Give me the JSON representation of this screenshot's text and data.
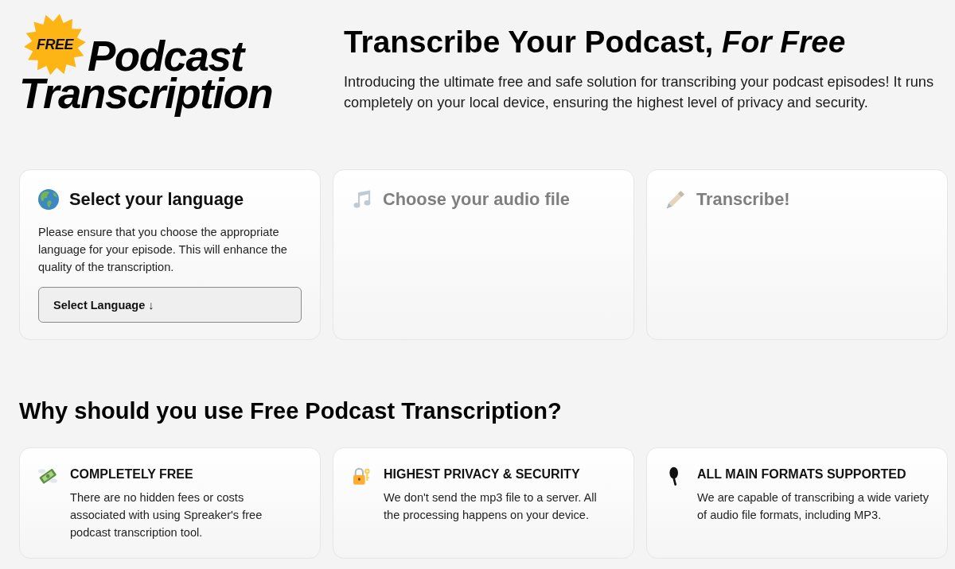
{
  "logo": {
    "badge": "FREE",
    "lines": [
      "Podcast",
      "Transcription"
    ]
  },
  "hero": {
    "title": "Transcribe Your Podcast, *For Free*",
    "intro": "Introducing the ultimate free and safe solution for transcribing your podcast episodes! It runs completely on your local device, ensuring the highest level of privacy and security."
  },
  "steps": [
    {
      "title": "Select your language",
      "disabled": false,
      "description": "Please ensure that you choose the appropriate language for your episode. This will enhance the quality of the transcription.",
      "button": "Select Language ↓"
    },
    {
      "title": "Choose your audio file",
      "disabled": true
    },
    {
      "title": "Transcribe!",
      "disabled": true
    }
  ],
  "features": {
    "heading": "Why should you use Free Podcast Transcription?",
    "items": [
      {
        "title": "COMPLETELY FREE",
        "description": "There are no hidden fees or costs associated with using Spreaker's free podcast transcription tool."
      },
      {
        "title": "HIGHEST PRIVACY & SECURITY",
        "description": "We don't send the mp3 file to a server. All the processing happens on your device."
      },
      {
        "title": "ALL MAIN FORMATS SUPPORTED",
        "description": "We are capable of transcribing a wide variety of audio file formats, including MP3."
      }
    ]
  }
}
